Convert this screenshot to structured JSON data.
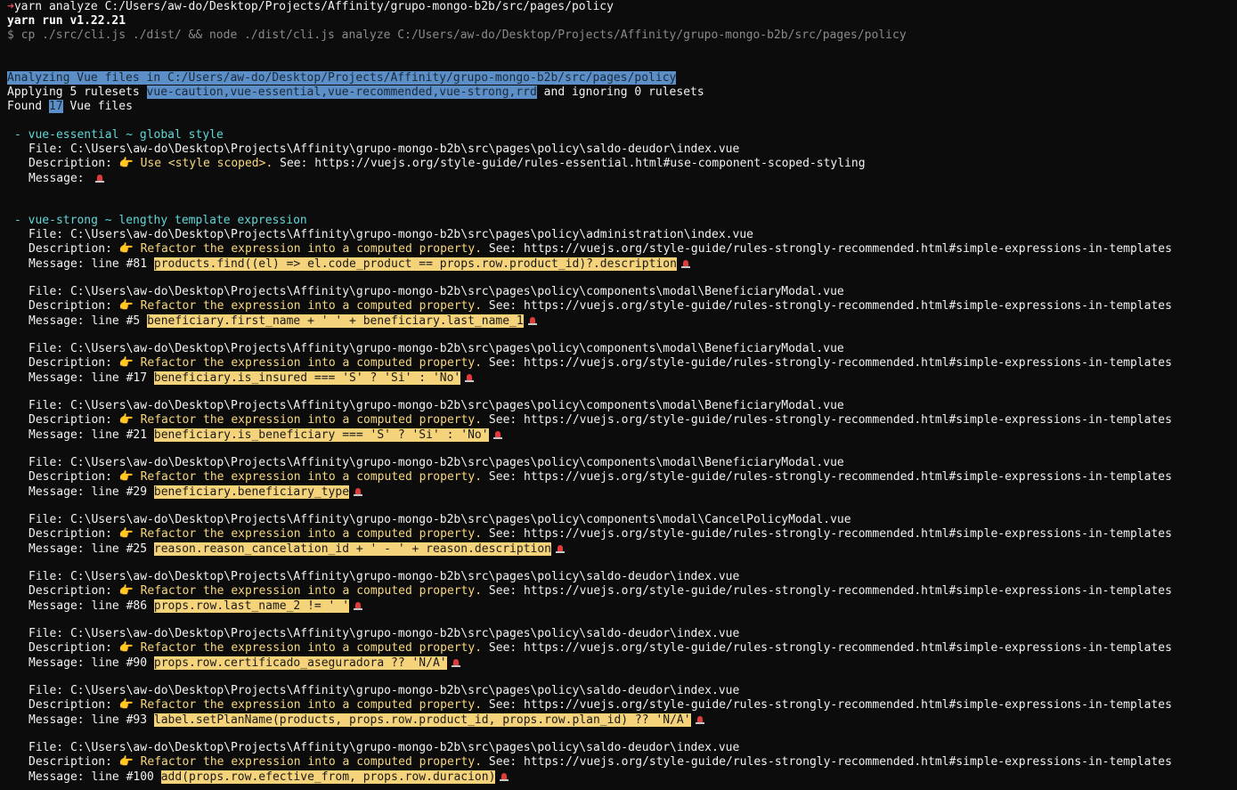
{
  "header": {
    "prompt_arrow": "➜",
    "command": "yarn analyze C:/Users/aw-do/Desktop/Projects/Affinity/grupo-mongo-b2b/src/pages/policy",
    "yarn_version": "yarn run v1.22.21",
    "exec_line": "$ cp ./src/cli.js ./dist/ && node ./dist/cli.js analyze C:/Users/aw-do/Desktop/Projects/Affinity/grupo-mongo-b2b/src/pages/policy"
  },
  "summary": {
    "analyzing": "Analyzing Vue files in C:/Users/aw-do/Desktop/Projects/Affinity/grupo-mongo-b2b/src/pages/policy",
    "applying_prefix": "Applying 5 rulesets ",
    "rulesets": "vue-caution,vue-essential,vue-recommended,vue-strong,rrd",
    "applying_suffix": " and ignoring 0 rulesets",
    "found_prefix": "Found ",
    "found_count": "17",
    "found_suffix": " Vue files"
  },
  "groups": [
    {
      "heading": "- vue-essential ~ global style",
      "items": [
        {
          "file": "File: C:\\Users\\aw-do\\Desktop\\Projects\\Affinity\\grupo-mongo-b2b\\src\\pages\\policy\\saldo-deudor\\index.vue",
          "desc_prefix": "Description: ",
          "desc_text": "Use <style scoped>.",
          "desc_see": " See: https://vuejs.org/style-guide/rules-essential.html#use-component-scoped-styling",
          "msg_prefix": "Message: ",
          "msg_code": ""
        }
      ]
    },
    {
      "heading": "- vue-strong ~ lengthy template expression",
      "items": [
        {
          "file": "File: C:\\Users\\aw-do\\Desktop\\Projects\\Affinity\\grupo-mongo-b2b\\src\\pages\\policy\\administration\\index.vue",
          "desc_prefix": "Description: ",
          "desc_text": "Refactor the expression into a computed property.",
          "desc_see": " See: https://vuejs.org/style-guide/rules-strongly-recommended.html#simple-expressions-in-templates",
          "msg_prefix": "Message: line #81 ",
          "msg_code": "products.find((el) => el.code_product == props.row.product_id)?.description"
        },
        {
          "file": "File: C:\\Users\\aw-do\\Desktop\\Projects\\Affinity\\grupo-mongo-b2b\\src\\pages\\policy\\components\\modal\\BeneficiaryModal.vue",
          "desc_prefix": "Description: ",
          "desc_text": "Refactor the expression into a computed property.",
          "desc_see": " See: https://vuejs.org/style-guide/rules-strongly-recommended.html#simple-expressions-in-templates",
          "msg_prefix": "Message: line #5 ",
          "msg_code": "beneficiary.first_name + ' ' + beneficiary.last_name_1"
        },
        {
          "file": "File: C:\\Users\\aw-do\\Desktop\\Projects\\Affinity\\grupo-mongo-b2b\\src\\pages\\policy\\components\\modal\\BeneficiaryModal.vue",
          "desc_prefix": "Description: ",
          "desc_text": "Refactor the expression into a computed property.",
          "desc_see": " See: https://vuejs.org/style-guide/rules-strongly-recommended.html#simple-expressions-in-templates",
          "msg_prefix": "Message: line #17 ",
          "msg_code": "beneficiary.is_insured === 'S' ? 'Si' : 'No'"
        },
        {
          "file": "File: C:\\Users\\aw-do\\Desktop\\Projects\\Affinity\\grupo-mongo-b2b\\src\\pages\\policy\\components\\modal\\BeneficiaryModal.vue",
          "desc_prefix": "Description: ",
          "desc_text": "Refactor the expression into a computed property.",
          "desc_see": " See: https://vuejs.org/style-guide/rules-strongly-recommended.html#simple-expressions-in-templates",
          "msg_prefix": "Message: line #21 ",
          "msg_code": "beneficiary.is_beneficiary === 'S' ? 'Si' : 'No'"
        },
        {
          "file": "File: C:\\Users\\aw-do\\Desktop\\Projects\\Affinity\\grupo-mongo-b2b\\src\\pages\\policy\\components\\modal\\BeneficiaryModal.vue",
          "desc_prefix": "Description: ",
          "desc_text": "Refactor the expression into a computed property.",
          "desc_see": " See: https://vuejs.org/style-guide/rules-strongly-recommended.html#simple-expressions-in-templates",
          "msg_prefix": "Message: line #29 ",
          "msg_code": "beneficiary.beneficiary_type"
        },
        {
          "file": "File: C:\\Users\\aw-do\\Desktop\\Projects\\Affinity\\grupo-mongo-b2b\\src\\pages\\policy\\components\\modal\\CancelPolicyModal.vue",
          "desc_prefix": "Description: ",
          "desc_text": "Refactor the expression into a computed property.",
          "desc_see": " See: https://vuejs.org/style-guide/rules-strongly-recommended.html#simple-expressions-in-templates",
          "msg_prefix": "Message: line #25 ",
          "msg_code": "reason.reason_cancelation_id + ' - ' + reason.description"
        },
        {
          "file": "File: C:\\Users\\aw-do\\Desktop\\Projects\\Affinity\\grupo-mongo-b2b\\src\\pages\\policy\\saldo-deudor\\index.vue",
          "desc_prefix": "Description: ",
          "desc_text": "Refactor the expression into a computed property.",
          "desc_see": " See: https://vuejs.org/style-guide/rules-strongly-recommended.html#simple-expressions-in-templates",
          "msg_prefix": "Message: line #86 ",
          "msg_code": "props.row.last_name_2 != ' '"
        },
        {
          "file": "File: C:\\Users\\aw-do\\Desktop\\Projects\\Affinity\\grupo-mongo-b2b\\src\\pages\\policy\\saldo-deudor\\index.vue",
          "desc_prefix": "Description: ",
          "desc_text": "Refactor the expression into a computed property.",
          "desc_see": " See: https://vuejs.org/style-guide/rules-strongly-recommended.html#simple-expressions-in-templates",
          "msg_prefix": "Message: line #90 ",
          "msg_code": "props.row.certificado_aseguradora ?? 'N/A'"
        },
        {
          "file": "File: C:\\Users\\aw-do\\Desktop\\Projects\\Affinity\\grupo-mongo-b2b\\src\\pages\\policy\\saldo-deudor\\index.vue",
          "desc_prefix": "Description: ",
          "desc_text": "Refactor the expression into a computed property.",
          "desc_see": " See: https://vuejs.org/style-guide/rules-strongly-recommended.html#simple-expressions-in-templates",
          "msg_prefix": "Message: line #93 ",
          "msg_code": "label.setPlanName(products, props.row.product_id, props.row.plan_id) ?? 'N/A'"
        },
        {
          "file": "File: C:\\Users\\aw-do\\Desktop\\Projects\\Affinity\\grupo-mongo-b2b\\src\\pages\\policy\\saldo-deudor\\index.vue",
          "desc_prefix": "Description: ",
          "desc_text": "Refactor the expression into a computed property.",
          "desc_see": " See: https://vuejs.org/style-guide/rules-strongly-recommended.html#simple-expressions-in-templates",
          "msg_prefix": "Message: line #100 ",
          "msg_code": "add(props.row.efective_from, props.row.duracion)"
        }
      ]
    }
  ],
  "icons": {
    "pointer": "👉",
    "siren": "siren-icon"
  }
}
